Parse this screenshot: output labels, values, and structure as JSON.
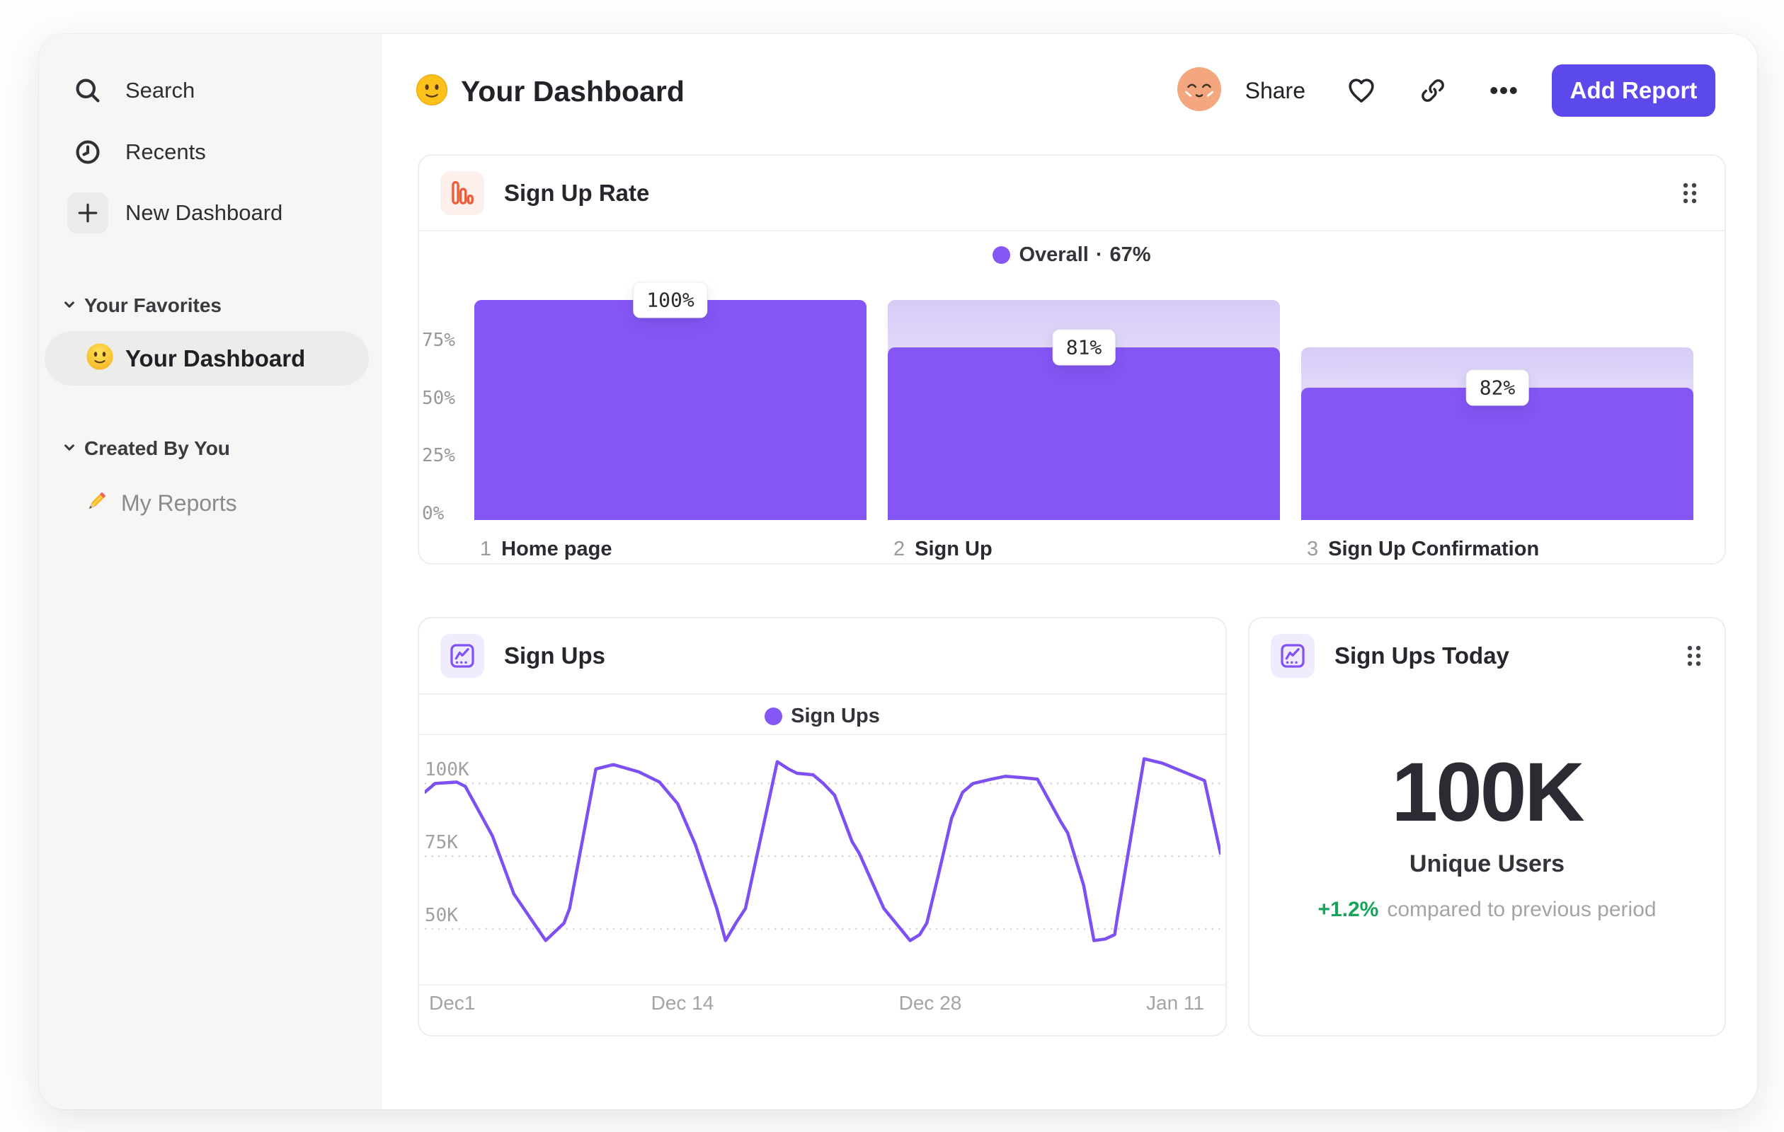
{
  "colors": {
    "accent_purple": "#8456F5",
    "line_purple": "#7E4FF2",
    "button_purple": "#5B49EC",
    "icon_orange": "#EC5C38",
    "positive_green": "#16A45C",
    "sidebar_bg": "#F6F6F4",
    "ghost_gradient_top": "#D7CBF7"
  },
  "sidebar": {
    "items": [
      {
        "label": "Search",
        "icon": "search-icon"
      },
      {
        "label": "Recents",
        "icon": "clock-icon"
      },
      {
        "label": "New Dashboard",
        "icon": "plus-icon"
      }
    ],
    "sections": [
      {
        "label": "Your Favorites",
        "items": [
          {
            "label": "Your Dashboard",
            "icon": "smiley-emoji",
            "selected": true
          }
        ]
      },
      {
        "label": "Created By You",
        "items": [
          {
            "label": "My Reports",
            "icon": "pencil-emoji",
            "selected": false
          }
        ]
      }
    ]
  },
  "header": {
    "title": "Your Dashboard",
    "share_label": "Share",
    "add_report_label": "Add Report"
  },
  "cards": {
    "funnel": {
      "title": "Sign Up Rate"
    },
    "line": {
      "title": "Sign Ups"
    },
    "kpi": {
      "title": "Sign Ups Today",
      "value": "100K",
      "unit_label": "Unique Users",
      "delta": "+1.2%",
      "delta_caption": "compared to previous period"
    }
  },
  "chart_data": [
    {
      "type": "bar",
      "subtype": "funnel",
      "title": "Sign Up Rate",
      "legend_label": "Overall",
      "legend_separator": "·",
      "legend_value": "67%",
      "legend_position": "top-center",
      "grid": false,
      "ylim": [
        0,
        100
      ],
      "y_ticks": [
        "75%",
        "50%",
        "25%",
        "0%"
      ],
      "steps": [
        {
          "num": "1",
          "name": "Home page",
          "conversion_label": "100%",
          "bar_pct": 100,
          "ghost_pct": null
        },
        {
          "num": "2",
          "name": "Sign Up",
          "conversion_label": "81%",
          "bar_pct": 78.5,
          "ghost_pct": 100
        },
        {
          "num": "3",
          "name": "Sign Up Confirmation",
          "conversion_label": "82%",
          "bar_pct": 60,
          "ghost_pct": 78.5
        }
      ]
    },
    {
      "type": "line",
      "title": "Sign Ups",
      "series_name": "Sign Ups",
      "legend_position": "top-center",
      "grid": "horizontal-dotted",
      "x_ticks": [
        "Dec1",
        "Dec 14",
        "Dec 28",
        "Jan 11"
      ],
      "y_ticks": [
        {
          "label": "100K",
          "value": 100
        },
        {
          "label": "75K",
          "value": 75
        },
        {
          "label": "50K",
          "value": 50
        }
      ],
      "y_window_k": [
        31,
        113
      ],
      "unit": "thousand sign ups per day",
      "points": [
        [
          0.0,
          97
        ],
        [
          0.013,
          100
        ],
        [
          0.04,
          100.5
        ],
        [
          0.051,
          99
        ],
        [
          0.085,
          82
        ],
        [
          0.112,
          62
        ],
        [
          0.152,
          46
        ],
        [
          0.175,
          52
        ],
        [
          0.182,
          57
        ],
        [
          0.215,
          105
        ],
        [
          0.237,
          106.5
        ],
        [
          0.269,
          104
        ],
        [
          0.295,
          100.5
        ],
        [
          0.318,
          93
        ],
        [
          0.34,
          79
        ],
        [
          0.367,
          57
        ],
        [
          0.378,
          46
        ],
        [
          0.391,
          52
        ],
        [
          0.403,
          57
        ],
        [
          0.443,
          107.5
        ],
        [
          0.457,
          105
        ],
        [
          0.468,
          103.5
        ],
        [
          0.488,
          103
        ],
        [
          0.501,
          100
        ],
        [
          0.515,
          96
        ],
        [
          0.537,
          80
        ],
        [
          0.546,
          76
        ],
        [
          0.577,
          57
        ],
        [
          0.61,
          46
        ],
        [
          0.622,
          48
        ],
        [
          0.631,
          52
        ],
        [
          0.645,
          68
        ],
        [
          0.662,
          88
        ],
        [
          0.676,
          97
        ],
        [
          0.689,
          100
        ],
        [
          0.712,
          101.5
        ],
        [
          0.73,
          102.5
        ],
        [
          0.752,
          102
        ],
        [
          0.77,
          101.5
        ],
        [
          0.783,
          95
        ],
        [
          0.799,
          87
        ],
        [
          0.808,
          83
        ],
        [
          0.828,
          65
        ],
        [
          0.841,
          46
        ],
        [
          0.855,
          46.5
        ],
        [
          0.867,
          48
        ],
        [
          0.871,
          55
        ],
        [
          0.904,
          108.5
        ],
        [
          0.927,
          107
        ],
        [
          0.967,
          102.5
        ],
        [
          0.98,
          101
        ],
        [
          1.0,
          76
        ]
      ]
    }
  ]
}
